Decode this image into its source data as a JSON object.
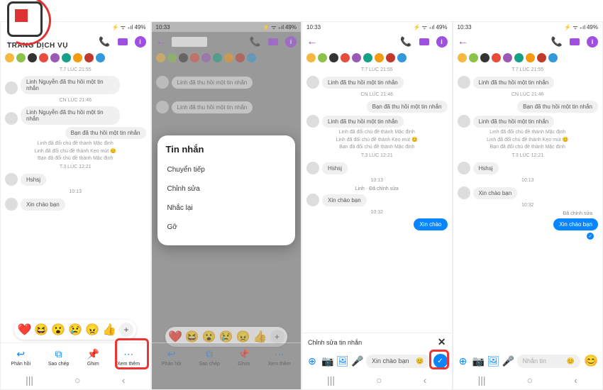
{
  "logo_text": "TRANG DỊCH VỤ",
  "status_bar": {
    "time": "10:33",
    "battery": "49%",
    "icons": "⚡ ᯤ ₊ıl"
  },
  "story_colors": [
    "#f5b942",
    "#8bc34a",
    "#333",
    "#e74c3c",
    "#9b59b6",
    "#16a085",
    "#f39c12",
    "#c0392b",
    "#3498db"
  ],
  "timestamps": {
    "t1": "T.7 LÚC 21:55",
    "t2": "CN LÚC 21:46",
    "t3": "T.3 LÚC 12:21",
    "t4": "10:13",
    "t5": "10:32"
  },
  "msgs": {
    "recall_a": "Linh Nguyễn đã thu hồi một tin nhắn",
    "recall_b": "Linh đã thu hồi một tin nhắn",
    "recall_c": "Bạn đã thu hồi một tin nhắn",
    "sys1": "Linh đã đổi chủ đề thành Mặc định",
    "sys2": "Linh đã đổi chủ đề thành Kẹo mút 😊",
    "sys3": "Bạn đã đổi chủ đề thành Mặc định",
    "hshsj": "Hshsj",
    "hello": "Xin chào bạn",
    "hello2": "Xin chào",
    "edited": "Linh · Đã chỉnh sửa",
    "edited2": "Đã chỉnh sửa"
  },
  "reactions": [
    "❤️",
    "😆",
    "😮",
    "😢",
    "😠",
    "👍"
  ],
  "actions": {
    "reply": "Phản hồi",
    "copy": "Sao chép",
    "pin": "Ghim",
    "more": "Xem thêm"
  },
  "sheet": {
    "title": "Tin nhắn",
    "forward": "Chuyển tiếp",
    "edit": "Chỉnh sửa",
    "remind": "Nhắc lại",
    "remove": "Gỡ"
  },
  "edit_header": "Chỉnh sửa tin nhắn",
  "compose_placeholder": "Nhắn tin",
  "compose_value": "Xin chào bạn"
}
